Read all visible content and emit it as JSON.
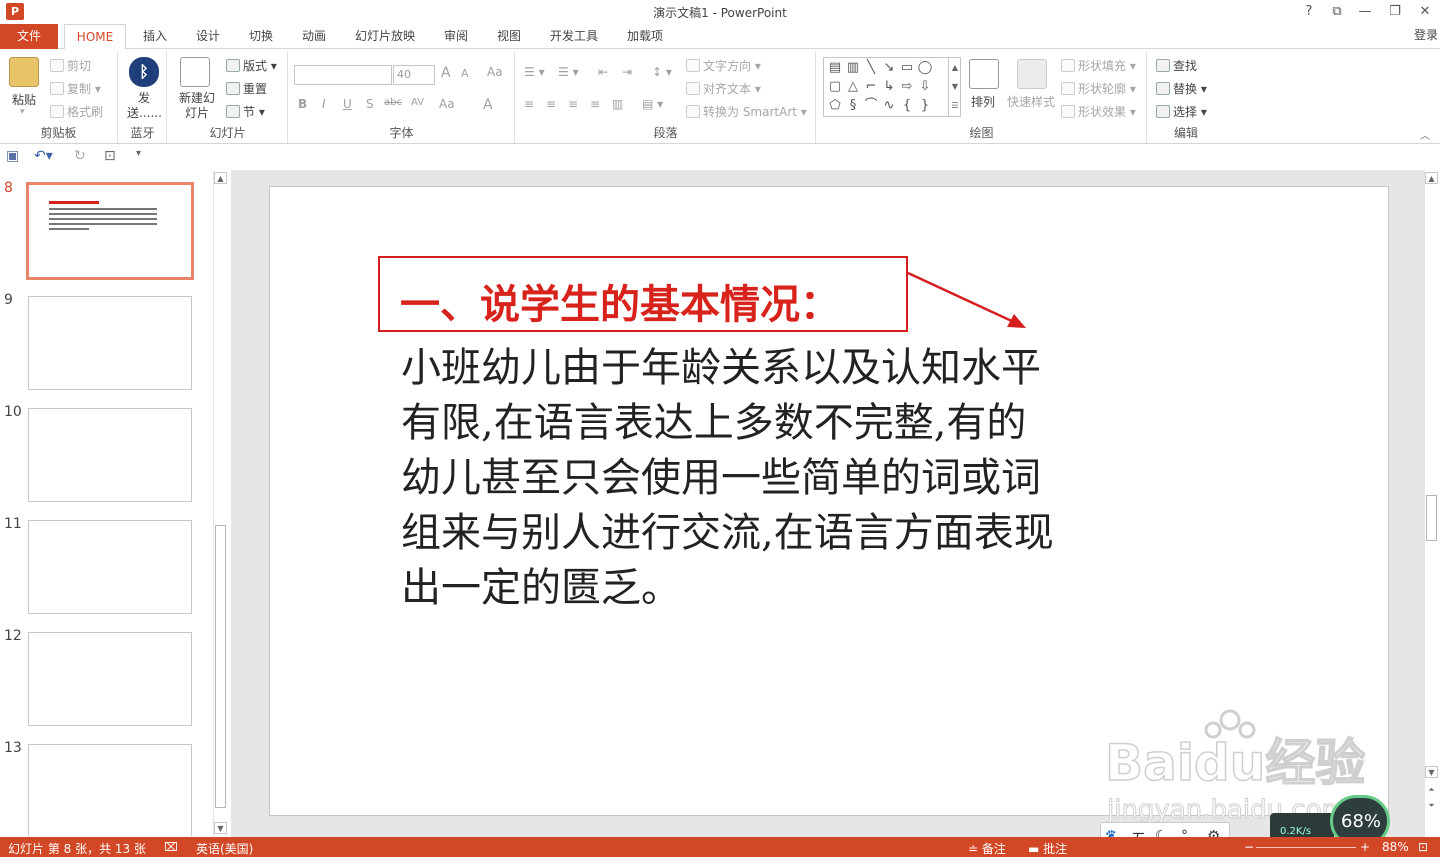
{
  "titlebar": {
    "app_logo": "P",
    "title": "演示文稿1 - PowerPoint",
    "help": "?",
    "ribbon_display": "⧉",
    "minimize": "—",
    "restore": "❐",
    "close": "✕"
  },
  "tabs": [
    "文件",
    "HOME",
    "插入",
    "设计",
    "切换",
    "动画",
    "幻灯片放映",
    "审阅",
    "视图",
    "开发工具",
    "加载项"
  ],
  "login": "登录",
  "ribbon": {
    "clipboard": {
      "paste": "粘贴",
      "cut": "剪切",
      "copy": "复制",
      "format_painter": "格式刷",
      "label": "剪贴板"
    },
    "bluetooth": {
      "send": "发送......",
      "label": "蓝牙"
    },
    "slides": {
      "new_slide": "新建幻灯片",
      "layout": "版式",
      "reset": "重置",
      "section": "节",
      "label": "幻灯片"
    },
    "font": {
      "font_size": "40",
      "grow": "A",
      "shrink": "A",
      "clear": "Aa",
      "bold": "B",
      "italic": "I",
      "underline": "U",
      "shadow": "S",
      "strike": "abc",
      "spacing": "AV",
      "case": "Aa",
      "color": "A",
      "label": "字体"
    },
    "paragraph": {
      "text_direction": "文字方向",
      "align_text": "对齐文本",
      "smartart": "转换为 SmartArt",
      "label": "段落"
    },
    "drawing": {
      "arrange": "排列",
      "quick_styles": "快速样式",
      "shape_fill": "形状填充",
      "shape_outline": "形状轮廓",
      "shape_effects": "形状效果",
      "label": "绘图"
    },
    "editing": {
      "find": "查找",
      "replace": "替换",
      "select": "选择",
      "label": "编辑"
    }
  },
  "thumbnails": [
    {
      "number": "8",
      "active": true
    },
    {
      "number": "9",
      "active": false
    },
    {
      "number": "10",
      "active": false
    },
    {
      "number": "11",
      "active": false
    },
    {
      "number": "12",
      "active": false
    },
    {
      "number": "13",
      "active": false
    }
  ],
  "slide": {
    "title": "一、说学生的基本情况：",
    "body_lines": [
      "小班幼儿由于年龄关系以及认知水平",
      "有限,在语言表达上多数不完整,有的",
      "幼儿甚至只会使用一些简单的词或词",
      "组来与别人进行交流,在语言方面表现",
      "出一定的匮乏。"
    ]
  },
  "statusbar": {
    "slide_info": "幻灯片 第 8 张，共 13 张",
    "language": "英语(美国)",
    "notes": "备注",
    "comments": "批注",
    "zoom": "88%"
  },
  "ime": {
    "mode": "五"
  },
  "net_widget": {
    "speed": "0.2K/s",
    "percent": "68%"
  },
  "watermark": {
    "brand": "Baidu经验",
    "url": "jingyan.baidu.com"
  },
  "colors": {
    "accent": "#d24726",
    "title_red": "#d8221c",
    "annotation_red": "#d51f1f"
  }
}
